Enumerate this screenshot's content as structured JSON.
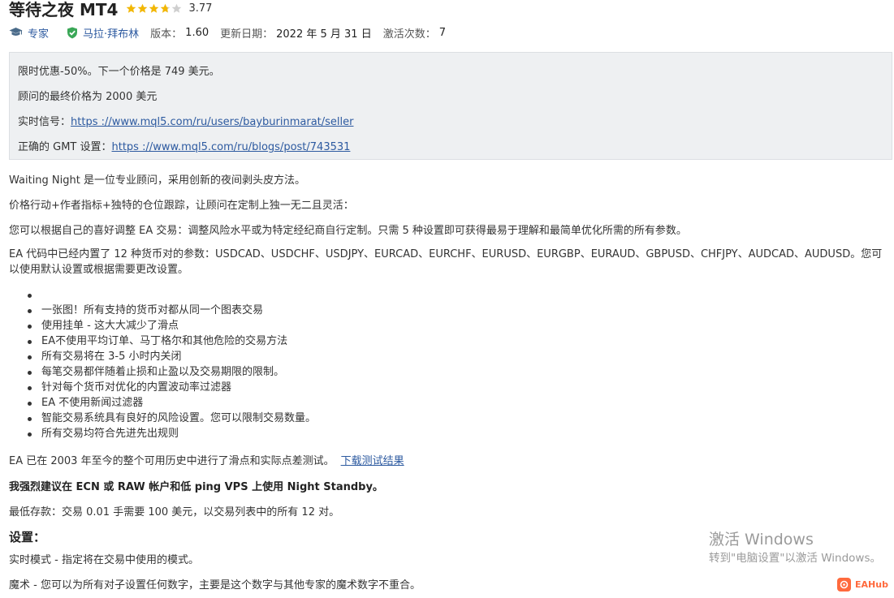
{
  "product": {
    "title": "等待之夜 MT4",
    "rating": "3.77",
    "rating_value": 3.77,
    "rating_max": 5
  },
  "meta": {
    "category": "专家",
    "author": "马拉·拜布林",
    "version_label": "版本：",
    "version": "1.60",
    "updated_label": "更新日期：",
    "updated": "2022 年 5 月 31 日",
    "activations_label": "激活次数：",
    "activations": "7"
  },
  "promo": {
    "line1": "限时优惠-50%。下一个价格是 749 美元。",
    "line2": "顾问的最终价格为 2000 美元",
    "signal_label": "实时信号：",
    "signal_link": "https ://www.mql5.com/ru/users/bayburinmarat/seller",
    "gmt_label": "正确的 GMT 设置：",
    "gmt_link": "https ://www.mql5.com/ru/blogs/post/743531"
  },
  "description": {
    "p1": "Waiting Night 是一位专业顾问，采用创新的夜间剥头皮方法。",
    "p2": "价格行动+作者指标+独特的仓位跟踪，让顾问在定制上独一无二且灵活：",
    "p3": "您可以根据自己的喜好调整 EA 交易：调整风险水平或为特定经纪商自行定制。只需 5 种设置即可获得最易于理解和最简单优化所需的所有参数。",
    "p4": "EA 代码中已经内置了 12 种货币对的参数：USDCAD、USDCHF、USDJPY、EURCAD、EURCHF、EURUSD、EURGBP、EURAUD、GBPUSD、CHFJPY、AUDCAD、AUDUSD。您可以使用默认设置或根据需要更改设置。",
    "features": [
      "",
      "一张图！所有支持的货币对都从同一个图表交易",
      "使用挂单 - 这大大减少了滑点",
      "EA不使用平均订单、马丁格尔和其他危险的交易方法",
      "所有交易将在 3-5 小时内关闭",
      "每笔交易都伴随着止损和止盈以及交易期限的限制。",
      "针对每个货币对优化的内置波动率过滤器",
      "EA 不使用新闻过滤器",
      "智能交易系统具有良好的风险设置。您可以限制交易数量。",
      "所有交易均符合先进先出规则"
    ],
    "p5": "EA 已在 2003 年至今的整个可用历史中进行了滑点和实际点差测试。",
    "p5_link": "下载测试结果",
    "p6": "我强烈建议在 ECN 或 RAW 帐户和低 ping VPS 上使用 Night Standby。",
    "p7": "最低存款：交易 0.01 手需要 100 美元，以交易列表中的所有 12 对。"
  },
  "settings": {
    "heading": "设置：",
    "item1": "实时模式 - 指定将在交易中使用的模式。",
    "item2": "魔术 - 您可以为所有对子设置任何数字，主要是这个数字与其他专家的魔术数字不重合。"
  },
  "overlay": {
    "activate_title": "激活 Windows",
    "activate_sub": "转到\"电脑设置\"以激活 Windows。",
    "watermark": "EAHub"
  },
  "colors": {
    "link": "#2d5aa0",
    "star": "#f2b705",
    "verified": "#3aa757",
    "promo_bg": "#eef0f2",
    "watermark": "#ff6a3d"
  },
  "icons": {
    "category": "graduation-cap-icon",
    "author": "verified-shield-icon",
    "rating": "star-icon"
  }
}
